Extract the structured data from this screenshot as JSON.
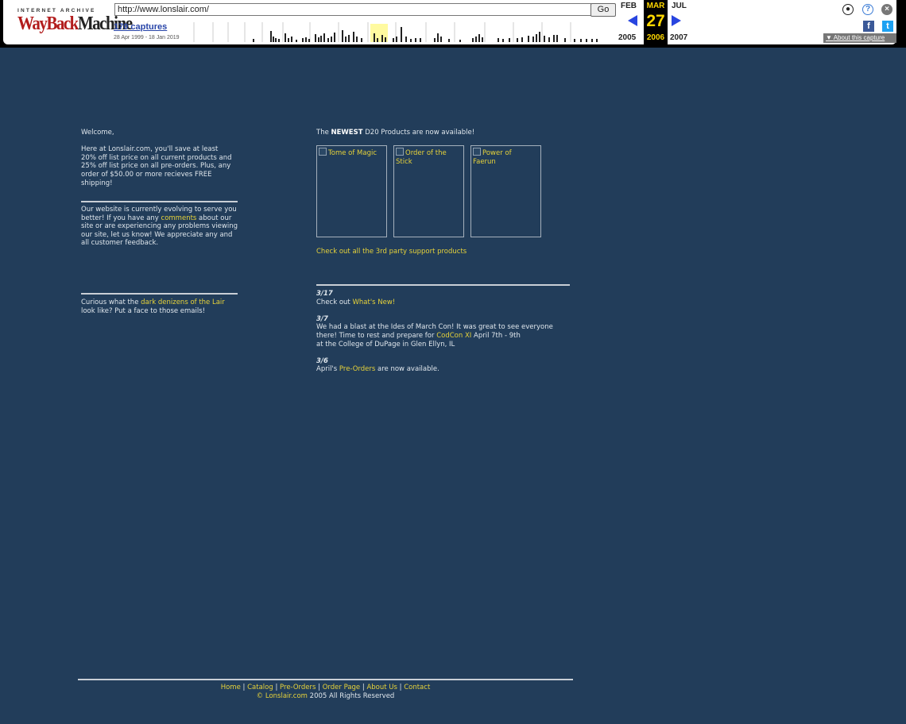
{
  "toolbar": {
    "logo_top": "INTERNET ARCHIVE",
    "logo_wayback": "WayBack",
    "logo_machine": "Machine",
    "url": "http://www.lonslair.com/",
    "go_label": "Go",
    "captures": "170 captures",
    "range": "28 Apr 1999 - 18 Jan 2019",
    "prev_month": "FEB",
    "cur_month": "MAR",
    "next_month": "JUL",
    "prev_year": "2005",
    "cur_year": "2006",
    "next_year": "2007",
    "cur_day": "27",
    "about": "About this capture",
    "fb_glyph": "f",
    "tw_glyph": "t",
    "help_glyph": "?",
    "close_glyph": "×",
    "user_glyph": "●",
    "icons": [
      "user-icon",
      "help-icon",
      "close-icon",
      "facebook-icon",
      "twitter-icon",
      "prev-arrow-icon",
      "next-arrow-icon"
    ],
    "colors": {
      "current_bg": "#000000",
      "current_fg": "#ffd800",
      "arrow": "#2845e0"
    }
  },
  "left": {
    "welcome": "Welcome,",
    "intro": "Here at Lonslair.com, you'll save at least 20% off list price on all current products and 25% off list price on all pre-orders. Plus, any order of $50.00 or more recieves FREE shipping!",
    "evolving_1": "Our website is currently evolving to serve you better! If you have any ",
    "evolving_link": "comments",
    "evolving_2": " about our site or are experiencing any problems viewing our site, let us know! We appreciate any and all customer feedback.",
    "curious_1": "Curious what the ",
    "curious_link": "dark denizens of the Lair",
    "curious_2": " look like? Put a face to those emails!"
  },
  "right": {
    "newest_1": "The ",
    "newest_bold": "NEWEST",
    "newest_2": " D20 Products are now available!",
    "products": [
      "Tome of Magic",
      "Order of the Stick",
      "Power of Faerun"
    ],
    "third_party": "Check out all the 3rd party support products",
    "news": [
      {
        "date": "3/17",
        "text_1": "Check out ",
        "link": "What's New!",
        "text_2": ""
      },
      {
        "date": "3/7",
        "text_1": "We had a blast at the Ides of March Con! It was great to see everyone there! Time to rest and prepare for ",
        "link": "CodCon XI",
        "text_2": " April 7th - 9th",
        "text_3": "at the College of DuPage in Glen Ellyn, IL"
      },
      {
        "date": "3/6",
        "text_1": "April's ",
        "link": "Pre-Orders",
        "text_2": " are now available."
      }
    ]
  },
  "footer": {
    "nav": [
      "Home",
      "Catalog",
      "Pre-Orders",
      "Order Page",
      "About Us",
      "Contact"
    ],
    "sep": "|",
    "copy_symbol": "©",
    "copy_link": "Lonslair.com",
    "copy_rest": " 2005 All Rights Reserved"
  },
  "colors": {
    "background": "#223d5a",
    "link": "#e6d23a",
    "text": "#dfe6ec"
  }
}
